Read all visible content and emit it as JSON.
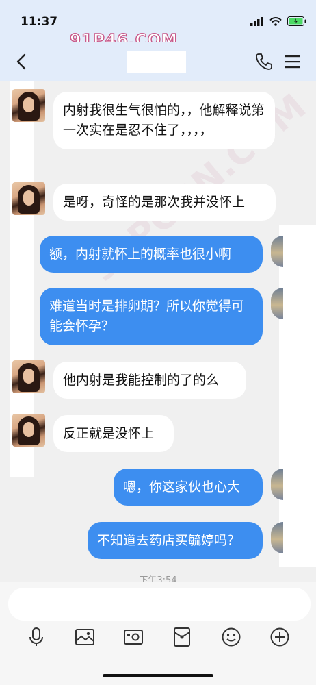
{
  "status": {
    "time": "11:37"
  },
  "header": {
    "watermark": "91P46.COM",
    "diag_watermark": "91PORN.COM"
  },
  "messages": [
    {
      "side": "in",
      "text": "内射我很生气很怕的，，他解释说第一次实在是忍不住了，，，，"
    },
    {
      "side": "in",
      "text": "是呀，奇怪的是那次我并没怀上"
    },
    {
      "side": "out",
      "text": "额，内射就怀上的概率也很小啊"
    },
    {
      "side": "out",
      "text": "难道当时是排卵期？所以你觉得可能会怀孕？"
    },
    {
      "side": "in",
      "text": "他内射是我能控制的了的么"
    },
    {
      "side": "in",
      "text": "反正就是没怀上"
    },
    {
      "side": "out",
      "text": "嗯，你这家伙也心大"
    },
    {
      "side": "out",
      "text": "不知道去药店买毓婷吗？"
    }
  ],
  "timestamp": "下午3:54",
  "input": {
    "placeholder": ""
  },
  "toolbar": [
    "microphone-icon",
    "image-icon",
    "camera-icon",
    "red-packet-icon",
    "emoji-icon",
    "plus-icon"
  ],
  "colors": {
    "out_bubble": "#3d8ef0",
    "in_bubble": "#ffffff",
    "background": "#f0f0f0"
  }
}
